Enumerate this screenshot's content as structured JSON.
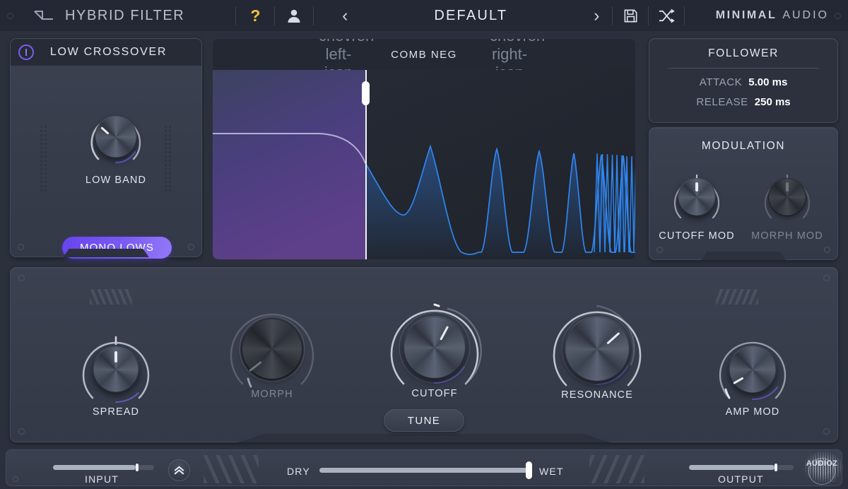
{
  "topbar": {
    "plugin_icon": "filter-curve-icon",
    "title": "HYBRID FILTER",
    "help_label": "?",
    "user_icon": "user-account-icon",
    "preset_prev": "‹",
    "preset_name": "DEFAULT",
    "preset_next": "›",
    "save_icon": "save-floppy-icon",
    "randomize_icon": "shuffle-randomize-icon",
    "brand_bold": "MINIMAL",
    "brand_light": "AUDIO"
  },
  "low_crossover": {
    "title": "LOW CROSSOVER",
    "power_icon": "power-toggle-icon",
    "power_on": true,
    "knob": {
      "label": "LOW BAND",
      "angle": -48
    },
    "mono_button": {
      "label": "MONO LOWS",
      "active": true,
      "color": "#7a5af2"
    }
  },
  "filter_display": {
    "prev_icon": "chevron-left-icon",
    "filter_name": "COMB NEG",
    "next_icon": "chevron-right-icon",
    "crossover_handle": "crossover-split-handle"
  },
  "follower": {
    "title": "FOLLOWER",
    "rows": [
      {
        "key": "ATTACK",
        "value": "5.00 ms"
      },
      {
        "key": "RELEASE",
        "value": "250 ms"
      }
    ]
  },
  "modulation": {
    "title": "MODULATION",
    "knobs": [
      {
        "label": "CUTOFF MOD",
        "angle": 0,
        "dim": false
      },
      {
        "label": "MORPH MOD",
        "angle": 0,
        "dim": true
      }
    ]
  },
  "main_knobs": [
    {
      "name": "spread",
      "label": "SPREAD",
      "angle": 0,
      "dim": false,
      "size": 84
    },
    {
      "name": "morph",
      "label": "MORPH",
      "angle": -128,
      "dim": true,
      "size": 104
    },
    {
      "name": "cutoff",
      "label": "CUTOFF",
      "angle": 28,
      "dim": false,
      "size": 116
    },
    {
      "name": "resonance",
      "label": "RESONANCE",
      "angle": 48,
      "dim": false,
      "size": 118
    },
    {
      "name": "amp_mod",
      "label": "AMP MOD",
      "angle": -120,
      "dim": false,
      "size": 86
    }
  ],
  "tune_button": {
    "label": "TUNE",
    "active": false
  },
  "bottom_bar": {
    "input": {
      "label": "INPUT",
      "value_pct": 82
    },
    "collapse_icon": "double-chevron-up-icon",
    "dry_label": "DRY",
    "wet_label": "WET",
    "mix_pct": 100,
    "output": {
      "label": "OUTPUT",
      "value_pct": 82
    }
  },
  "watermark": {
    "text": "AUDIOZ"
  },
  "colors": {
    "background": "#2b303c",
    "panel": "#3a4050",
    "topbar": "#232834",
    "display": "#232833",
    "accent_purple": "#7a5af2",
    "accent_blue": "#2f7fe8",
    "help_yellow": "#f0c33c",
    "text_primary": "#e3e7ef",
    "text_dim": "#8a919f"
  }
}
